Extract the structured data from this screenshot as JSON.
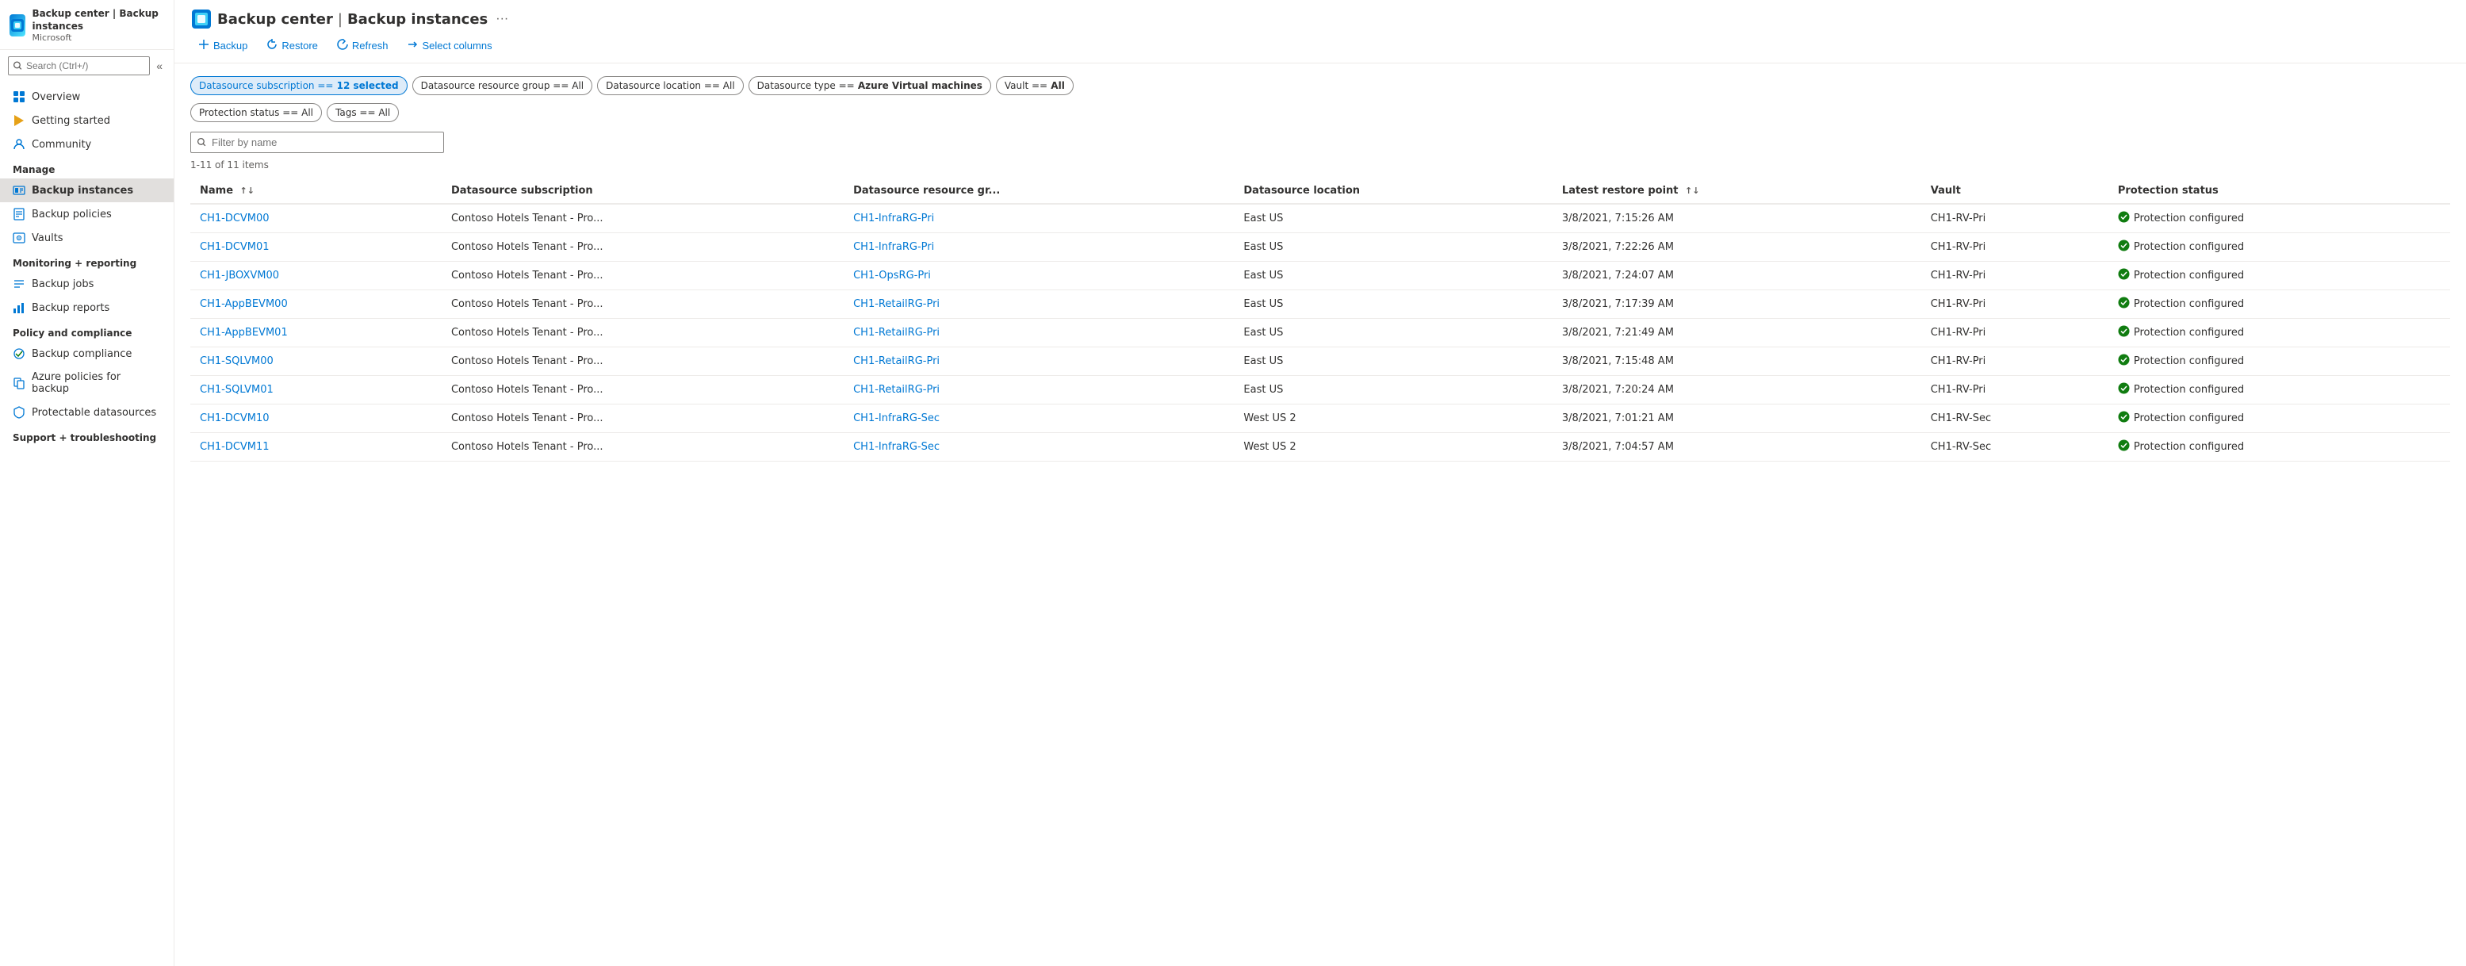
{
  "app": {
    "icon": "☁",
    "title": "Backup center | Backup instances",
    "subtitle": "Microsoft",
    "more_label": "···"
  },
  "sidebar": {
    "search_placeholder": "Search (Ctrl+/)",
    "collapse_icon": "«",
    "nav_items": [
      {
        "id": "overview",
        "label": "Overview",
        "icon": "🏠"
      },
      {
        "id": "getting-started",
        "label": "Getting started",
        "icon": "🚀"
      },
      {
        "id": "community",
        "label": "Community",
        "icon": "☁"
      }
    ],
    "manage_section": "Manage",
    "manage_items": [
      {
        "id": "backup-instances",
        "label": "Backup instances",
        "icon": "🗄",
        "active": true
      },
      {
        "id": "backup-policies",
        "label": "Backup policies",
        "icon": "📋"
      },
      {
        "id": "vaults",
        "label": "Vaults",
        "icon": "🏦"
      }
    ],
    "monitoring_section": "Monitoring + reporting",
    "monitoring_items": [
      {
        "id": "backup-jobs",
        "label": "Backup jobs",
        "icon": "≡"
      },
      {
        "id": "backup-reports",
        "label": "Backup reports",
        "icon": "📊"
      }
    ],
    "policy_section": "Policy and compliance",
    "policy_items": [
      {
        "id": "backup-compliance",
        "label": "Backup compliance",
        "icon": "✔"
      },
      {
        "id": "azure-policies",
        "label": "Azure policies for backup",
        "icon": "📁"
      },
      {
        "id": "protectable-datasources",
        "label": "Protectable datasources",
        "icon": "🔒"
      }
    ],
    "support_section": "Support + troubleshooting"
  },
  "toolbar": {
    "backup_label": "Backup",
    "restore_label": "Restore",
    "refresh_label": "Refresh",
    "select_columns_label": "Select columns"
  },
  "filters": [
    {
      "id": "datasource-subscription",
      "label": "Datasource subscription == ",
      "value": "12 selected",
      "selected": true
    },
    {
      "id": "datasource-resource-group",
      "label": "Datasource resource group == ",
      "value": "All",
      "selected": false
    },
    {
      "id": "datasource-location",
      "label": "Datasource location == ",
      "value": "All",
      "selected": false
    },
    {
      "id": "datasource-type",
      "label": "Datasource type == ",
      "value": "Azure Virtual machines",
      "bold": true,
      "selected": false
    },
    {
      "id": "vault",
      "label": "Vault == ",
      "value": "All",
      "selected": false
    },
    {
      "id": "protection-status",
      "label": "Protection status == ",
      "value": "All",
      "selected": false
    },
    {
      "id": "tags",
      "label": "Tags == ",
      "value": "All",
      "selected": false
    }
  ],
  "filter_name": {
    "placeholder": "Filter by name"
  },
  "items_count": "1-11 of 11 items",
  "table": {
    "columns": [
      {
        "id": "name",
        "label": "Name",
        "sortable": true
      },
      {
        "id": "datasource-subscription",
        "label": "Datasource subscription",
        "sortable": false
      },
      {
        "id": "datasource-resource-group",
        "label": "Datasource resource gr...",
        "sortable": false
      },
      {
        "id": "datasource-location",
        "label": "Datasource location",
        "sortable": false
      },
      {
        "id": "latest-restore-point",
        "label": "Latest restore point",
        "sortable": true
      },
      {
        "id": "vault",
        "label": "Vault",
        "sortable": false
      },
      {
        "id": "protection-status",
        "label": "Protection status",
        "sortable": false
      }
    ],
    "rows": [
      {
        "name": "CH1-DCVM00",
        "subscription": "Contoso Hotels Tenant - Pro...",
        "resource_group": "CH1-InfraRG-Pri",
        "location": "East US",
        "restore_point": "3/8/2021, 7:15:26 AM",
        "vault": "CH1-RV-Pri",
        "status": "Protection configured"
      },
      {
        "name": "CH1-DCVM01",
        "subscription": "Contoso Hotels Tenant - Pro...",
        "resource_group": "CH1-InfraRG-Pri",
        "location": "East US",
        "restore_point": "3/8/2021, 7:22:26 AM",
        "vault": "CH1-RV-Pri",
        "status": "Protection configured"
      },
      {
        "name": "CH1-JBOXVM00",
        "subscription": "Contoso Hotels Tenant - Pro...",
        "resource_group": "CH1-OpsRG-Pri",
        "location": "East US",
        "restore_point": "3/8/2021, 7:24:07 AM",
        "vault": "CH1-RV-Pri",
        "status": "Protection configured"
      },
      {
        "name": "CH1-AppBEVM00",
        "subscription": "Contoso Hotels Tenant - Pro...",
        "resource_group": "CH1-RetailRG-Pri",
        "location": "East US",
        "restore_point": "3/8/2021, 7:17:39 AM",
        "vault": "CH1-RV-Pri",
        "status": "Protection configured"
      },
      {
        "name": "CH1-AppBEVM01",
        "subscription": "Contoso Hotels Tenant - Pro...",
        "resource_group": "CH1-RetailRG-Pri",
        "location": "East US",
        "restore_point": "3/8/2021, 7:21:49 AM",
        "vault": "CH1-RV-Pri",
        "status": "Protection configured"
      },
      {
        "name": "CH1-SQLVM00",
        "subscription": "Contoso Hotels Tenant - Pro...",
        "resource_group": "CH1-RetailRG-Pri",
        "location": "East US",
        "restore_point": "3/8/2021, 7:15:48 AM",
        "vault": "CH1-RV-Pri",
        "status": "Protection configured"
      },
      {
        "name": "CH1-SQLVM01",
        "subscription": "Contoso Hotels Tenant - Pro...",
        "resource_group": "CH1-RetailRG-Pri",
        "location": "East US",
        "restore_point": "3/8/2021, 7:20:24 AM",
        "vault": "CH1-RV-Pri",
        "status": "Protection configured"
      },
      {
        "name": "CH1-DCVM10",
        "subscription": "Contoso Hotels Tenant - Pro...",
        "resource_group": "CH1-InfraRG-Sec",
        "location": "West US 2",
        "restore_point": "3/8/2021, 7:01:21 AM",
        "vault": "CH1-RV-Sec",
        "status": "Protection configured"
      },
      {
        "name": "CH1-DCVM11",
        "subscription": "Contoso Hotels Tenant - Pro...",
        "resource_group": "CH1-InfraRG-Sec",
        "location": "West US 2",
        "restore_point": "3/8/2021, 7:04:57 AM",
        "vault": "CH1-RV-Sec",
        "status": "Protection configured"
      }
    ]
  }
}
